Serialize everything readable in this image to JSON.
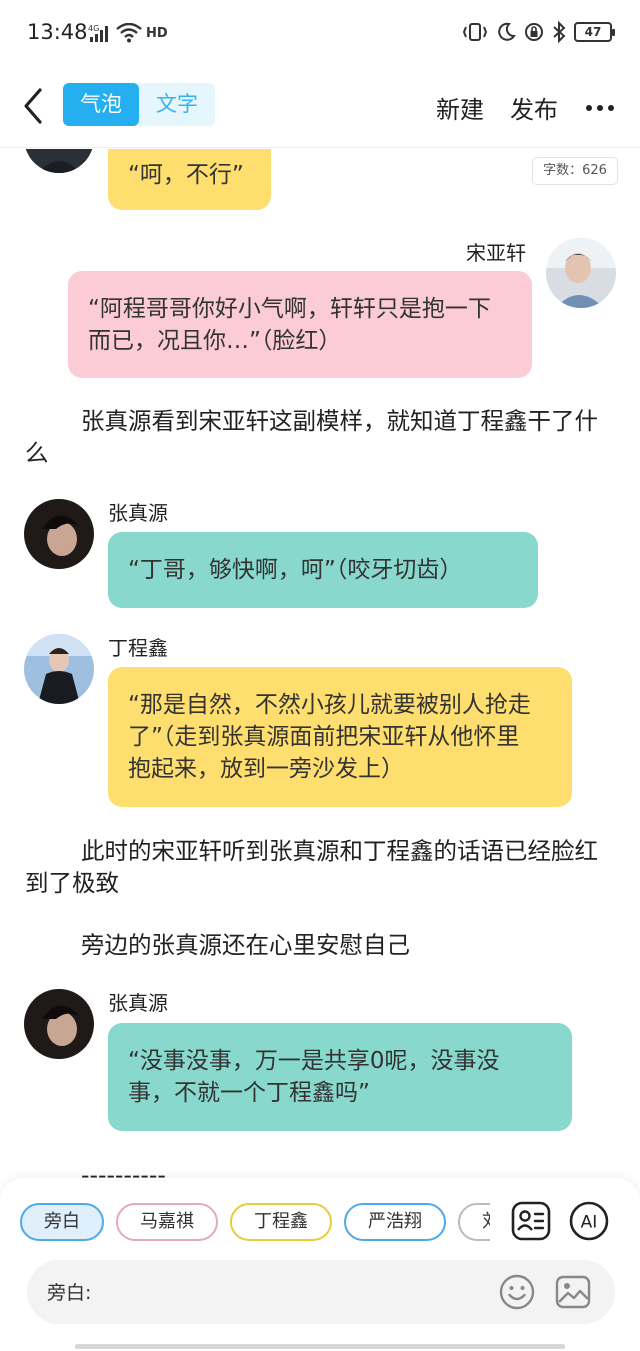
{
  "status_bar": {
    "time": "13:48",
    "network": "4G",
    "hd": "HD",
    "battery": "47"
  },
  "header": {
    "back_icon": "chevron-left-icon",
    "mode_bubble": "气泡",
    "mode_text": "文字",
    "new_label": "新建",
    "publish_label": "发布",
    "more_icon": "more-dots-icon",
    "accent": "#25aef0"
  },
  "word_count": "字数：626",
  "messages": [
    {
      "type": "bubble",
      "side": "left",
      "color": "#fede6e",
      "text": "“呵，不行”"
    },
    {
      "type": "bubble",
      "side": "right",
      "speaker": "宋亚轩",
      "color": "#fbcbd6",
      "text": "“阿程哥哥你好小气啊，轩轩只是抱一下而已，况且你…”（脸红）"
    },
    {
      "type": "narration",
      "text": "张真源看到宋亚轩这副模样，就知道丁程鑫干了什么"
    },
    {
      "type": "bubble",
      "side": "left",
      "speaker": "张真源",
      "color": "#88d8cd",
      "text": "“丁哥，够快啊，呵”（咬牙切齿）"
    },
    {
      "type": "bubble",
      "side": "left",
      "speaker": "丁程鑫",
      "color": "#fede6e",
      "text": "“那是自然，不然小孩儿就要被别人抢走了”（走到张真源面前把宋亚轩从他怀里抱起来，放到一旁沙发上）"
    },
    {
      "type": "narration",
      "text": "此时的宋亚轩听到张真源和丁程鑫的话语已经脸红到了极致"
    },
    {
      "type": "narration",
      "text": "旁边的张真源还在心里安慰自己"
    },
    {
      "type": "bubble",
      "side": "left",
      "speaker": "张真源",
      "color": "#88d8cd",
      "text": "“没事没事，万一是共享0呢，没事没事，不就一个丁程鑫吗”"
    },
    {
      "type": "narration",
      "text": "----------"
    }
  ],
  "characters": [
    "旁白",
    "马嘉祺",
    "丁程鑫",
    "严浩翔",
    "刘耀"
  ],
  "tools": {
    "character_card_icon": "character-card-icon",
    "ai_label": "AI"
  },
  "input": {
    "label": "旁白:",
    "emoji_icon": "smiley-icon",
    "image_icon": "image-icon"
  }
}
